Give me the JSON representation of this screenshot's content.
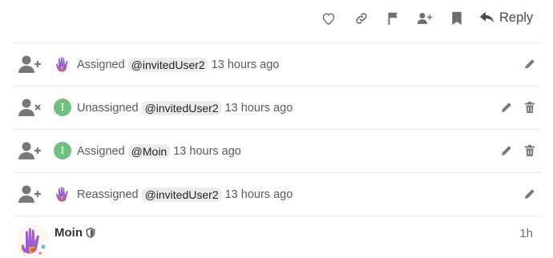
{
  "toolbar": {
    "icons": [
      "heart-icon",
      "link-icon",
      "flag-icon",
      "add-user-icon",
      "bookmark-icon"
    ],
    "reply_label": "Reply"
  },
  "events": [
    {
      "icon": "user-plus-icon",
      "avatar": "hand-avatar",
      "verb": "Assigned",
      "mention": "@invitedUser2",
      "time": "13 hours ago",
      "can_delete": false
    },
    {
      "icon": "user-remove-icon",
      "avatar": "letter-avatar",
      "avatar_letter": "I",
      "verb": "Unassigned",
      "mention": "@invitedUser2",
      "time": "13 hours ago",
      "can_delete": true
    },
    {
      "icon": "user-plus-icon",
      "avatar": "letter-avatar",
      "avatar_letter": "I",
      "verb": "Assigned",
      "mention": "@Moin",
      "time": "13 hours ago",
      "can_delete": true
    },
    {
      "icon": "user-plus-icon",
      "avatar": "hand-avatar",
      "verb": "Reassigned",
      "mention": "@invitedUser2",
      "time": "13 hours ago",
      "can_delete": false
    }
  ],
  "post": {
    "username": "Moin",
    "badge": "shield-icon",
    "time": "1h"
  },
  "colors": {
    "icon": "#6e6e6e",
    "avatar_green": "#6fc07f",
    "mention_bg": "#ececec",
    "divider": "#e9e9e9"
  }
}
